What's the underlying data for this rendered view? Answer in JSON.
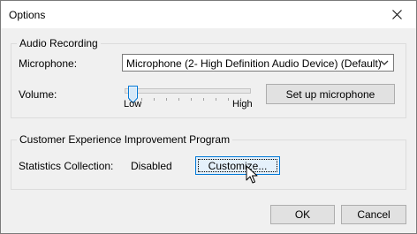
{
  "window": {
    "title": "Options",
    "close_icon": "close-icon"
  },
  "audio_recording": {
    "title": "Audio Recording",
    "microphone_label": "Microphone:",
    "microphone_value": "Microphone (2- High Definition Audio Device) (Default)",
    "volume_label": "Volume:",
    "volume_low": "Low",
    "volume_high": "High",
    "volume_level": 0.03,
    "setup_button": "Set up microphone"
  },
  "ceip": {
    "title": "Customer Experience Improvement Program",
    "statistics_label": "Statistics Collection:",
    "statistics_value": "Disabled",
    "customize_button": "Customize..."
  },
  "footer": {
    "ok_button": "OK",
    "cancel_button": "Cancel"
  }
}
